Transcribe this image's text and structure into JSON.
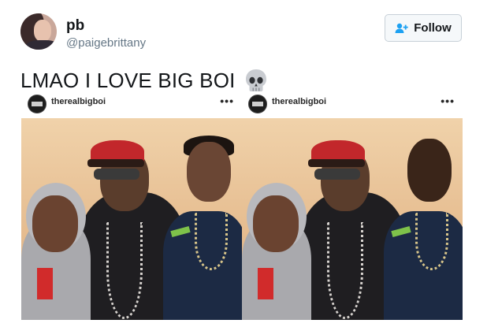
{
  "tweet": {
    "display_name": "pb",
    "handle": "@paigebrittany",
    "follow_label": "Follow",
    "text": "LMAO I LOVE BIG BOI"
  },
  "images": [
    {
      "username": "therealbigboi",
      "more": "•••"
    },
    {
      "username": "therealbigboi",
      "more": "•••"
    }
  ],
  "icons": {
    "follow_icon": "add-user-icon",
    "emoji": "skull-icon"
  },
  "colors": {
    "follow_border": "#c7d0d8",
    "follow_icon": "#1da1f2",
    "handle": "#657786"
  }
}
